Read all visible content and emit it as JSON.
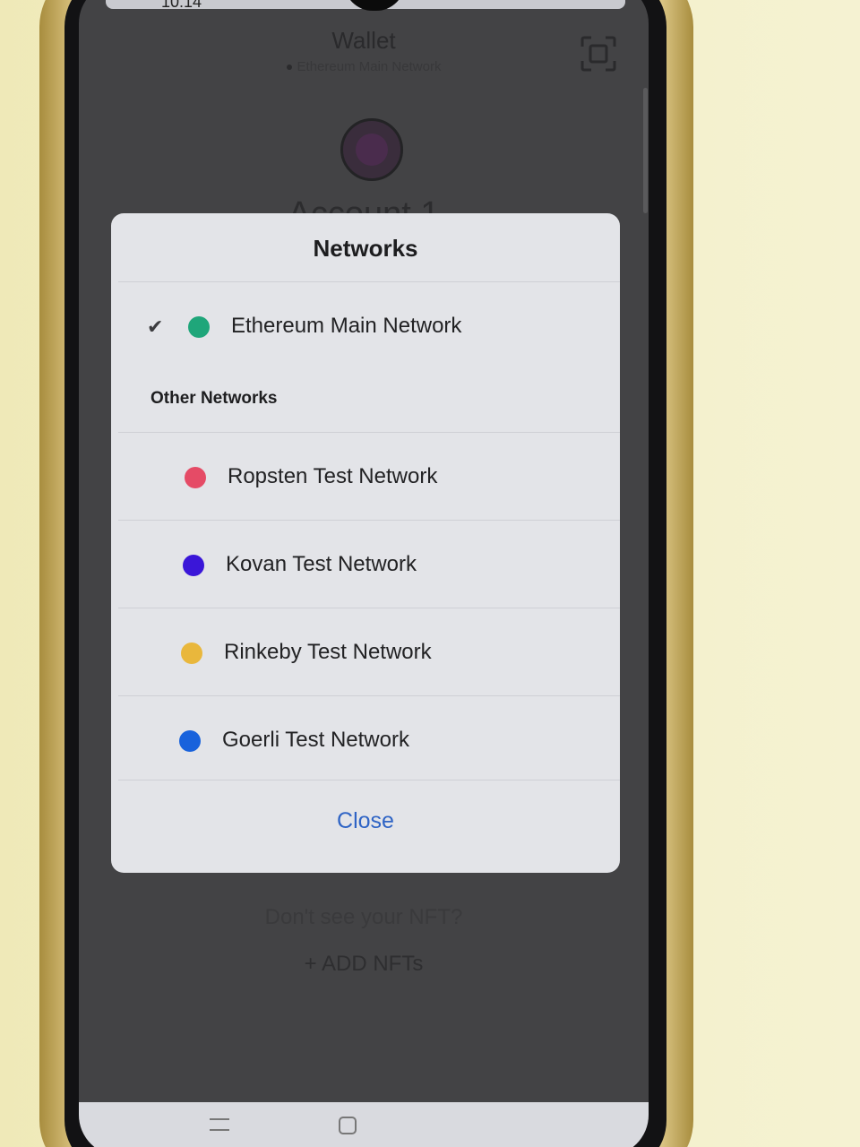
{
  "status": {
    "time": "10:14"
  },
  "header": {
    "title": "Wallet",
    "network": "Ethereum Main Network",
    "scan_icon": "scan-qr-icon"
  },
  "account": {
    "name": "Account 1"
  },
  "background_content": {
    "nft_prompt": "Don't see your NFT?",
    "add_nfts": "+ ADD NFTs"
  },
  "modal": {
    "title": "Networks",
    "selected": {
      "label": "Ethereum Main Network",
      "color": "#1fa67a",
      "check_icon": "checkmark-icon"
    },
    "section_label": "Other Networks",
    "networks": [
      {
        "label": "Ropsten Test Network",
        "color": "#e54b66"
      },
      {
        "label": "Kovan Test Network",
        "color": "#3a16d8"
      },
      {
        "label": "Rinkeby Test Network",
        "color": "#e9b73c"
      },
      {
        "label": "Goerli Test Network",
        "color": "#1862dc"
      }
    ],
    "close_label": "Close"
  },
  "colors": {
    "accent": "#2f64c5",
    "modal_bg": "#e3e4e8",
    "app_bg": "#434345"
  }
}
